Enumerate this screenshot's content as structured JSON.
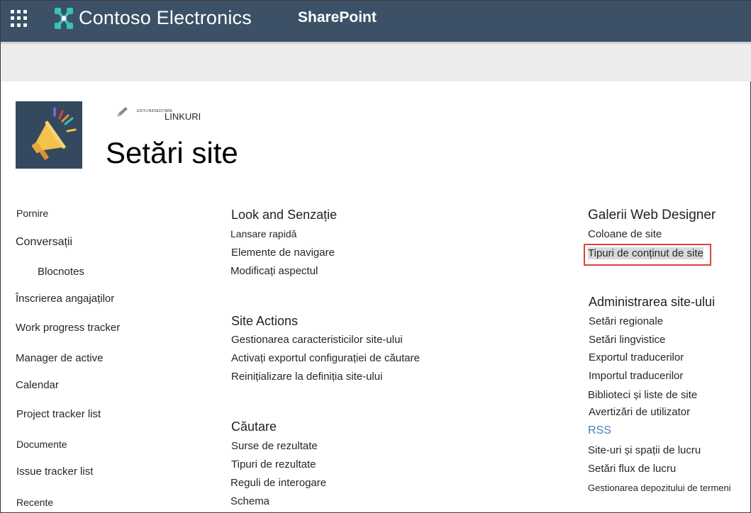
{
  "suite_bar": {
    "brand": "Contoso Electronics",
    "product": "SharePoint"
  },
  "site_header": {
    "edit_small": "EDITLINKSEDITARE",
    "edit_links": "LINKURI",
    "title": "Setări site"
  },
  "left_nav": [
    "Pornire",
    "Conversații",
    "Blocnotes",
    "Înscrierea angajaților",
    "Work progress tracker",
    "Manager de active",
    "Calendar",
    "Project tracker list",
    "Documente",
    "Issue tracker list",
    "Recente"
  ],
  "look_and_feel": {
    "heading": "Look and  Senzație",
    "links": [
      "Lansare rapidă",
      "Elemente de navigare",
      "Modificați aspectul"
    ]
  },
  "site_actions": {
    "heading": "Site Actions",
    "links": [
      "Gestionarea caracteristicilor site-ului",
      "Activați exportul configurației de căutare",
      "Reinițializare la definiția site-ului"
    ]
  },
  "search": {
    "heading": "Căutare",
    "links": [
      "Surse de rezultate",
      "Tipuri de rezultate",
      "Reguli de interogare",
      "Schema"
    ]
  },
  "web_designer": {
    "heading": "Galerii Web Designer",
    "links": [
      "Coloane de site",
      "Tipuri de conținut de site"
    ]
  },
  "site_admin": {
    "heading": "Administrarea site-ului",
    "links": [
      "Setări regionale",
      "Setări lingvistice",
      "Exportul traducerilor",
      "Importul traducerilor",
      "Biblioteci și liste de site",
      "Avertizări de utilizator",
      "RSS",
      "Site-uri și spații de lucru",
      "Setări flux de lucru",
      "Gestionarea depozitului de termeni"
    ]
  },
  "colors": {
    "suite_bar": "#3c5166",
    "brand_teal": "#3cc0b4",
    "logo_tile": "#34495e",
    "highlight_border": "#e0413a",
    "rss": "#4a7bc0"
  },
  "icons": {
    "app_launcher": "waffle-icon",
    "brand": "contoso-logo-icon",
    "edit": "pencil-icon",
    "site_logo": "megaphone-icon"
  }
}
